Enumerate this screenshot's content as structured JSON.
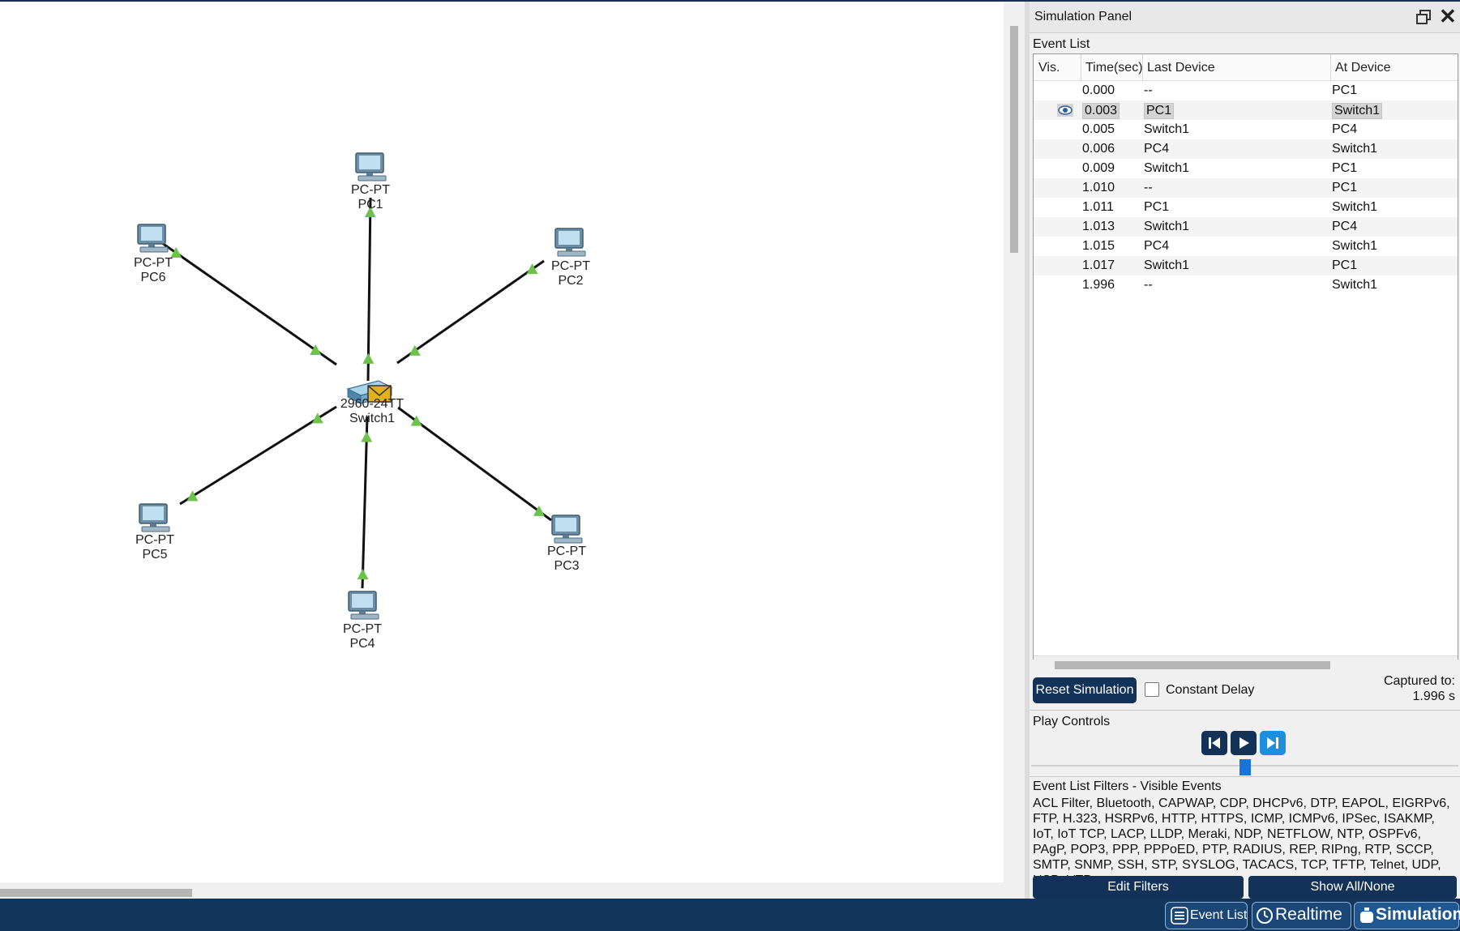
{
  "workspace": {
    "devices": [
      {
        "id": "pc1",
        "model": "PC-PT",
        "name": "PC1"
      },
      {
        "id": "pc2",
        "model": "PC-PT",
        "name": "PC2"
      },
      {
        "id": "pc3",
        "model": "PC-PT",
        "name": "PC3"
      },
      {
        "id": "pc4",
        "model": "PC-PT",
        "name": "PC4"
      },
      {
        "id": "pc5",
        "model": "PC-PT",
        "name": "PC5"
      },
      {
        "id": "pc6",
        "model": "PC-PT",
        "name": "PC6"
      },
      {
        "id": "sw1",
        "model": "2960-24TT",
        "name": "Switch1"
      }
    ]
  },
  "panel": {
    "title": "Simulation Panel",
    "event_list_label": "Event List",
    "columns": [
      "Vis.",
      "Time(sec)",
      "Last Device",
      "At Device"
    ],
    "events": [
      {
        "time": "0.000",
        "last": "--",
        "at": "PC1",
        "current": false
      },
      {
        "time": "0.003",
        "last": "PC1",
        "at": "Switch1",
        "current": true
      },
      {
        "time": "0.005",
        "last": "Switch1",
        "at": "PC4",
        "current": false
      },
      {
        "time": "0.006",
        "last": "PC4",
        "at": "Switch1",
        "current": false
      },
      {
        "time": "0.009",
        "last": "Switch1",
        "at": "PC1",
        "current": false
      },
      {
        "time": "1.010",
        "last": "--",
        "at": "PC1",
        "current": false
      },
      {
        "time": "1.011",
        "last": "PC1",
        "at": "Switch1",
        "current": false
      },
      {
        "time": "1.013",
        "last": "Switch1",
        "at": "PC4",
        "current": false
      },
      {
        "time": "1.015",
        "last": "PC4",
        "at": "Switch1",
        "current": false
      },
      {
        "time": "1.017",
        "last": "Switch1",
        "at": "PC1",
        "current": false
      },
      {
        "time": "1.996",
        "last": "--",
        "at": "Switch1",
        "current": false
      }
    ],
    "reset_label": "Reset Simulation",
    "constant_delay_label": "Constant Delay",
    "constant_delay_checked": false,
    "captured_label": "Captured to:",
    "captured_value": "1.996 s",
    "play_controls_label": "Play Controls",
    "filters_title": "Event List Filters - Visible Events",
    "filters_text": "ACL Filter, Bluetooth, CAPWAP, CDP, DHCPv6, DTP, EAPOL, EIGRPv6, FTP, H.323, HSRPv6, HTTP, HTTPS, ICMP, ICMPv6, IPSec, ISAKMP, IoT, IoT TCP, LACP, LLDP, Meraki, NDP, NETFLOW, NTP, OSPFv6, PAgP, POP3, PPP, PPPoED, PTP, RADIUS, REP, RIPng, RTP, SCCP, SMTP, SNMP, SSH, STP, SYSLOG, TACACS, TCP, TFTP, Telnet, UDP, USB, VTP",
    "edit_filters_label": "Edit Filters",
    "show_all_label": "Show All/None"
  },
  "taskbar": {
    "event_list": "Event List",
    "realtime": "Realtime",
    "simulation": "Simulation"
  },
  "colors": {
    "link": "#111111",
    "link_light": "#6cc24a",
    "accent": "#123257",
    "pdu": "#e1b21d"
  }
}
